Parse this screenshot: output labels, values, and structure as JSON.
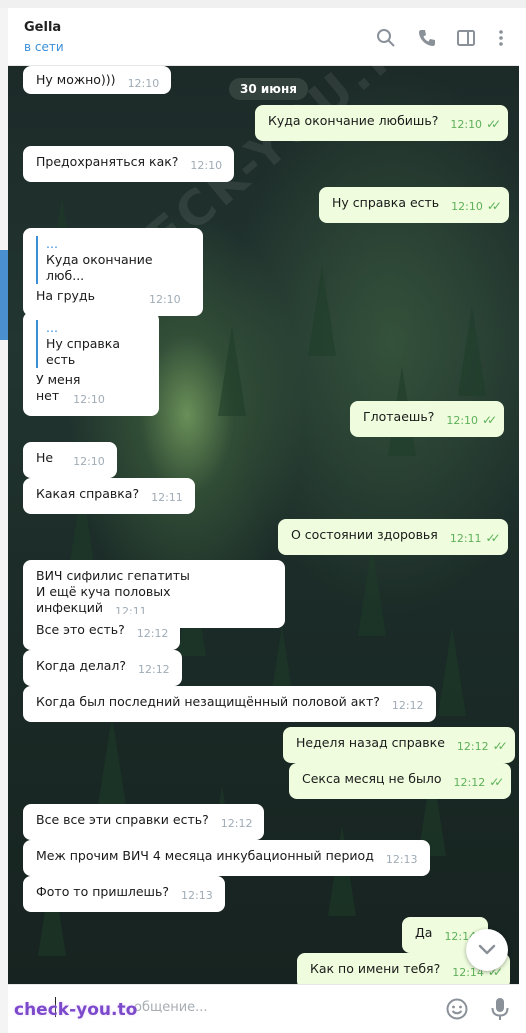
{
  "header": {
    "name": "Gella",
    "status": "в сети"
  },
  "watermark": "CHECK-YOU.ME",
  "date_separator": "30 июня",
  "messages": [
    {
      "dir": "in",
      "text": "Ну можно)))",
      "time": "12:10"
    },
    {
      "dir": "out",
      "text": "Куда окончание любишь?",
      "time": "12:10"
    },
    {
      "dir": "in",
      "text": "Предохраняться как?",
      "time": "12:10"
    },
    {
      "dir": "out",
      "text": "Ну справка есть",
      "time": "12:10"
    },
    {
      "dir": "in",
      "reply_dots": "...",
      "reply_text": "Куда окончание люб...",
      "text": "На грудь",
      "time": "12:10"
    },
    {
      "dir": "in",
      "reply_dots": "...",
      "reply_text": "Ну справка есть",
      "text": "У меня нет",
      "time": "12:10"
    },
    {
      "dir": "out",
      "text": "Глотаешь?",
      "time": "12:10"
    },
    {
      "dir": "in",
      "text": "Не",
      "time": "12:10"
    },
    {
      "dir": "in",
      "text": "Какая справка?",
      "time": "12:11"
    },
    {
      "dir": "out",
      "text": "О состоянии здоровья",
      "time": "12:11"
    },
    {
      "dir": "in",
      "text_line1": "ВИЧ сифилис гепатиты",
      "text_line2": "И ещё куча половых инфекций",
      "time": "12:11"
    },
    {
      "dir": "in",
      "text": "Все это есть?",
      "time": "12:12"
    },
    {
      "dir": "in",
      "text": "Когда делал?",
      "time": "12:12"
    },
    {
      "dir": "in",
      "text": "Когда был последний незащищённый половой акт?",
      "time": "12:12"
    },
    {
      "dir": "out",
      "text": "Неделя назад справке",
      "time": "12:12"
    },
    {
      "dir": "out",
      "text": "Секса месяц не было",
      "time": "12:12"
    },
    {
      "dir": "in",
      "text": "Все все эти справки есть?",
      "time": "12:12"
    },
    {
      "dir": "in",
      "text": "Меж прочим ВИЧ 4 месяца инкубационный период",
      "time": "12:13"
    },
    {
      "dir": "in",
      "text": "Фото то пришлешь?",
      "time": "12:13"
    },
    {
      "dir": "out",
      "text": "Да",
      "time": "12:14"
    },
    {
      "dir": "out",
      "text": "Как по имени тебя?",
      "time": "12:14"
    }
  ],
  "footer": {
    "placeholder": "общение...",
    "brand": "check-you.to"
  },
  "icons": [
    "search-icon",
    "phone-icon",
    "sidebar-toggle-icon",
    "more-vertical-icon",
    "emoji-icon",
    "microphone-icon",
    "chevron-down-icon",
    "double-check-icon"
  ]
}
